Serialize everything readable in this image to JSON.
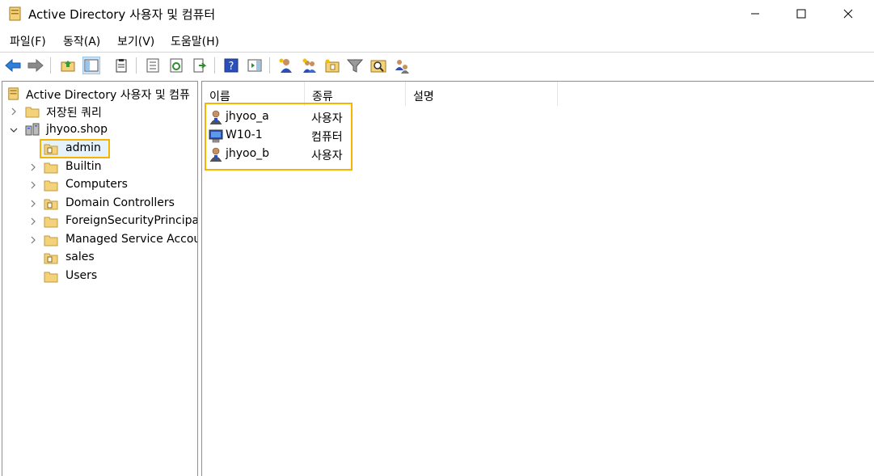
{
  "window": {
    "title": "Active Directory 사용자 및 컴퓨터"
  },
  "menu": {
    "items": [
      "파일(F)",
      "동작(A)",
      "보기(V)",
      "도움말(H)"
    ]
  },
  "toolbar": {
    "icons": [
      "back-icon",
      "forward-icon",
      "up-folder-icon",
      "show-hide-tree-icon",
      "clipboard-icon",
      "properties-icon",
      "refresh-icon",
      "export-list-icon",
      "help-icon",
      "show-action-pane-icon",
      "new-user-icon",
      "new-group-icon",
      "new-ou-icon",
      "filter-icon",
      "find-icon",
      "add-to-group-icon"
    ]
  },
  "tree": {
    "root": "Active Directory 사용자 및 컴퓨",
    "saved_queries": "저장된 쿼리",
    "domain": "jhyoo.shop",
    "children": [
      {
        "label": "admin",
        "selected": true,
        "expandable": false,
        "ou": true
      },
      {
        "label": "Builtin",
        "expandable": true,
        "ou": false
      },
      {
        "label": "Computers",
        "expandable": true,
        "ou": false
      },
      {
        "label": "Domain Controllers",
        "expandable": true,
        "ou": true
      },
      {
        "label": "ForeignSecurityPrincipals",
        "expandable": true,
        "ou": false
      },
      {
        "label": "Managed Service Accour",
        "expandable": true,
        "ou": false
      },
      {
        "label": "sales",
        "expandable": false,
        "ou": true
      },
      {
        "label": "Users",
        "expandable": false,
        "ou": false
      }
    ]
  },
  "list": {
    "columns": [
      "이름",
      "종류",
      "설명"
    ],
    "rows": [
      {
        "name": "jhyoo_a",
        "type": "사용자",
        "icon": "user-icon"
      },
      {
        "name": "W10-1",
        "type": "컴퓨터",
        "icon": "computer-icon"
      },
      {
        "name": "jhyoo_b",
        "type": "사용자",
        "icon": "user-icon"
      }
    ]
  },
  "colors": {
    "highlight": "#f5b400",
    "folder": "#f3d27a",
    "accent_blue": "#1e6fd0"
  }
}
